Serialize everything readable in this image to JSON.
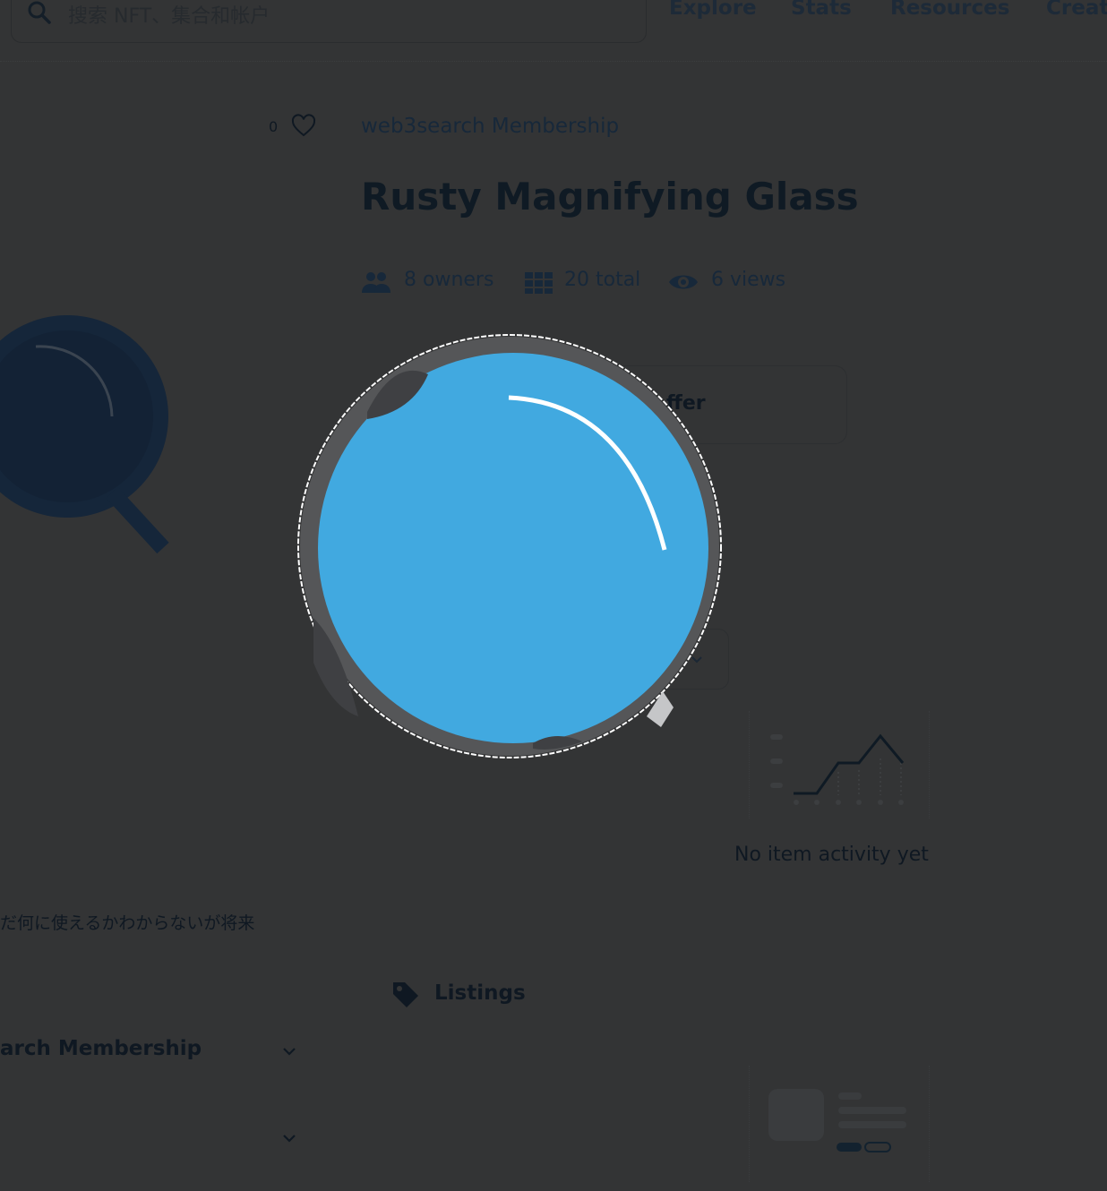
{
  "header": {
    "search_placeholder": "搜索 NFT、集合和帐户",
    "nav": [
      "Explore",
      "Stats",
      "Resources",
      "Creat"
    ]
  },
  "item": {
    "favorites_count": "0",
    "collection_name": "web3search Membership",
    "title": "Rusty Magnifying Glass",
    "stats": {
      "owners": "8 owners",
      "total": "20 total",
      "views": "6 views"
    },
    "offer_button": "ffer"
  },
  "activity": {
    "empty_text": "No item activity yet"
  },
  "description": {
    "text": "だ何に使えるかわからないが将来"
  },
  "listings": {
    "label": "Listings"
  },
  "sections": {
    "collection_section_title": "arch Membership"
  },
  "colors": {
    "overlay_bg": "#333435",
    "lens_blue": "#41a9e0",
    "rim_gray": "#555658",
    "dark_text": "#0f1a24"
  }
}
